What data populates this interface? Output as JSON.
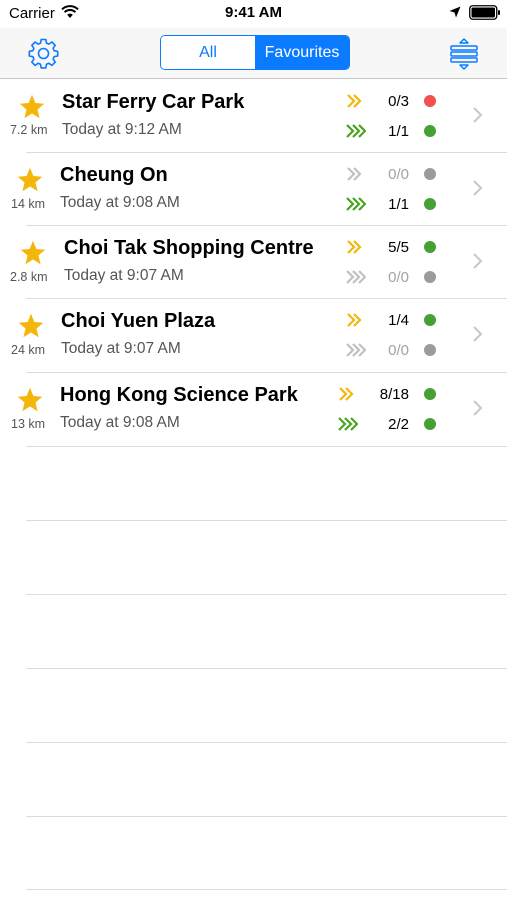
{
  "status_bar": {
    "carrier": "Carrier",
    "time": "9:41 AM",
    "icons": [
      "wifi-icon",
      "location-arrow-icon",
      "battery-icon"
    ]
  },
  "nav": {
    "segments": [
      {
        "label": "All",
        "selected": false
      },
      {
        "label": "Favourites",
        "selected": true
      }
    ],
    "left_icon": "gear-icon",
    "right_icon": "sort-layers-icon"
  },
  "colors": {
    "accent": "#0a7aff",
    "star": "#f5b60b",
    "chevron_yellow": "#f5b60b",
    "chevron_green": "#4aa320",
    "chevron_grey": "#c0c0c0",
    "dot_red": "#f05050",
    "dot_green": "#46a135",
    "dot_grey": "#9b9b9b"
  },
  "parks": [
    {
      "name": "Star Ferry Car Park",
      "distance": "7.2 km",
      "time": "Today at 9:12 AM",
      "lanes": [
        {
          "chevrons": 2,
          "color": "yellow",
          "count": "0/3",
          "status": "red",
          "dim": false
        },
        {
          "chevrons": 3,
          "color": "green",
          "count": "1/1",
          "status": "green",
          "dim": false
        }
      ]
    },
    {
      "name": "Cheung On",
      "distance": "14 km",
      "time": "Today at 9:08 AM",
      "lanes": [
        {
          "chevrons": 2,
          "color": "grey",
          "count": "0/0",
          "status": "grey",
          "dim": true
        },
        {
          "chevrons": 3,
          "color": "green",
          "count": "1/1",
          "status": "green",
          "dim": false
        }
      ]
    },
    {
      "name": "Choi Tak Shopping Centre",
      "distance": "2.8 km",
      "time": "Today at 9:07 AM",
      "lanes": [
        {
          "chevrons": 2,
          "color": "yellow",
          "count": "5/5",
          "status": "green",
          "dim": false
        },
        {
          "chevrons": 3,
          "color": "grey",
          "count": "0/0",
          "status": "grey",
          "dim": true
        }
      ]
    },
    {
      "name": "Choi Yuen Plaza",
      "distance": "24 km",
      "time": "Today at 9:07 AM",
      "lanes": [
        {
          "chevrons": 2,
          "color": "yellow",
          "count": "1/4",
          "status": "green",
          "dim": false
        },
        {
          "chevrons": 3,
          "color": "grey",
          "count": "0/0",
          "status": "grey",
          "dim": true
        }
      ]
    },
    {
      "name": "Hong Kong Science Park",
      "distance": "13 km",
      "time": "Today at 9:08 AM",
      "lanes": [
        {
          "chevrons": 2,
          "color": "yellow",
          "count": "8/18",
          "status": "green",
          "dim": false
        },
        {
          "chevrons": 3,
          "color": "green",
          "count": "2/2",
          "status": "green",
          "dim": false
        }
      ]
    }
  ]
}
